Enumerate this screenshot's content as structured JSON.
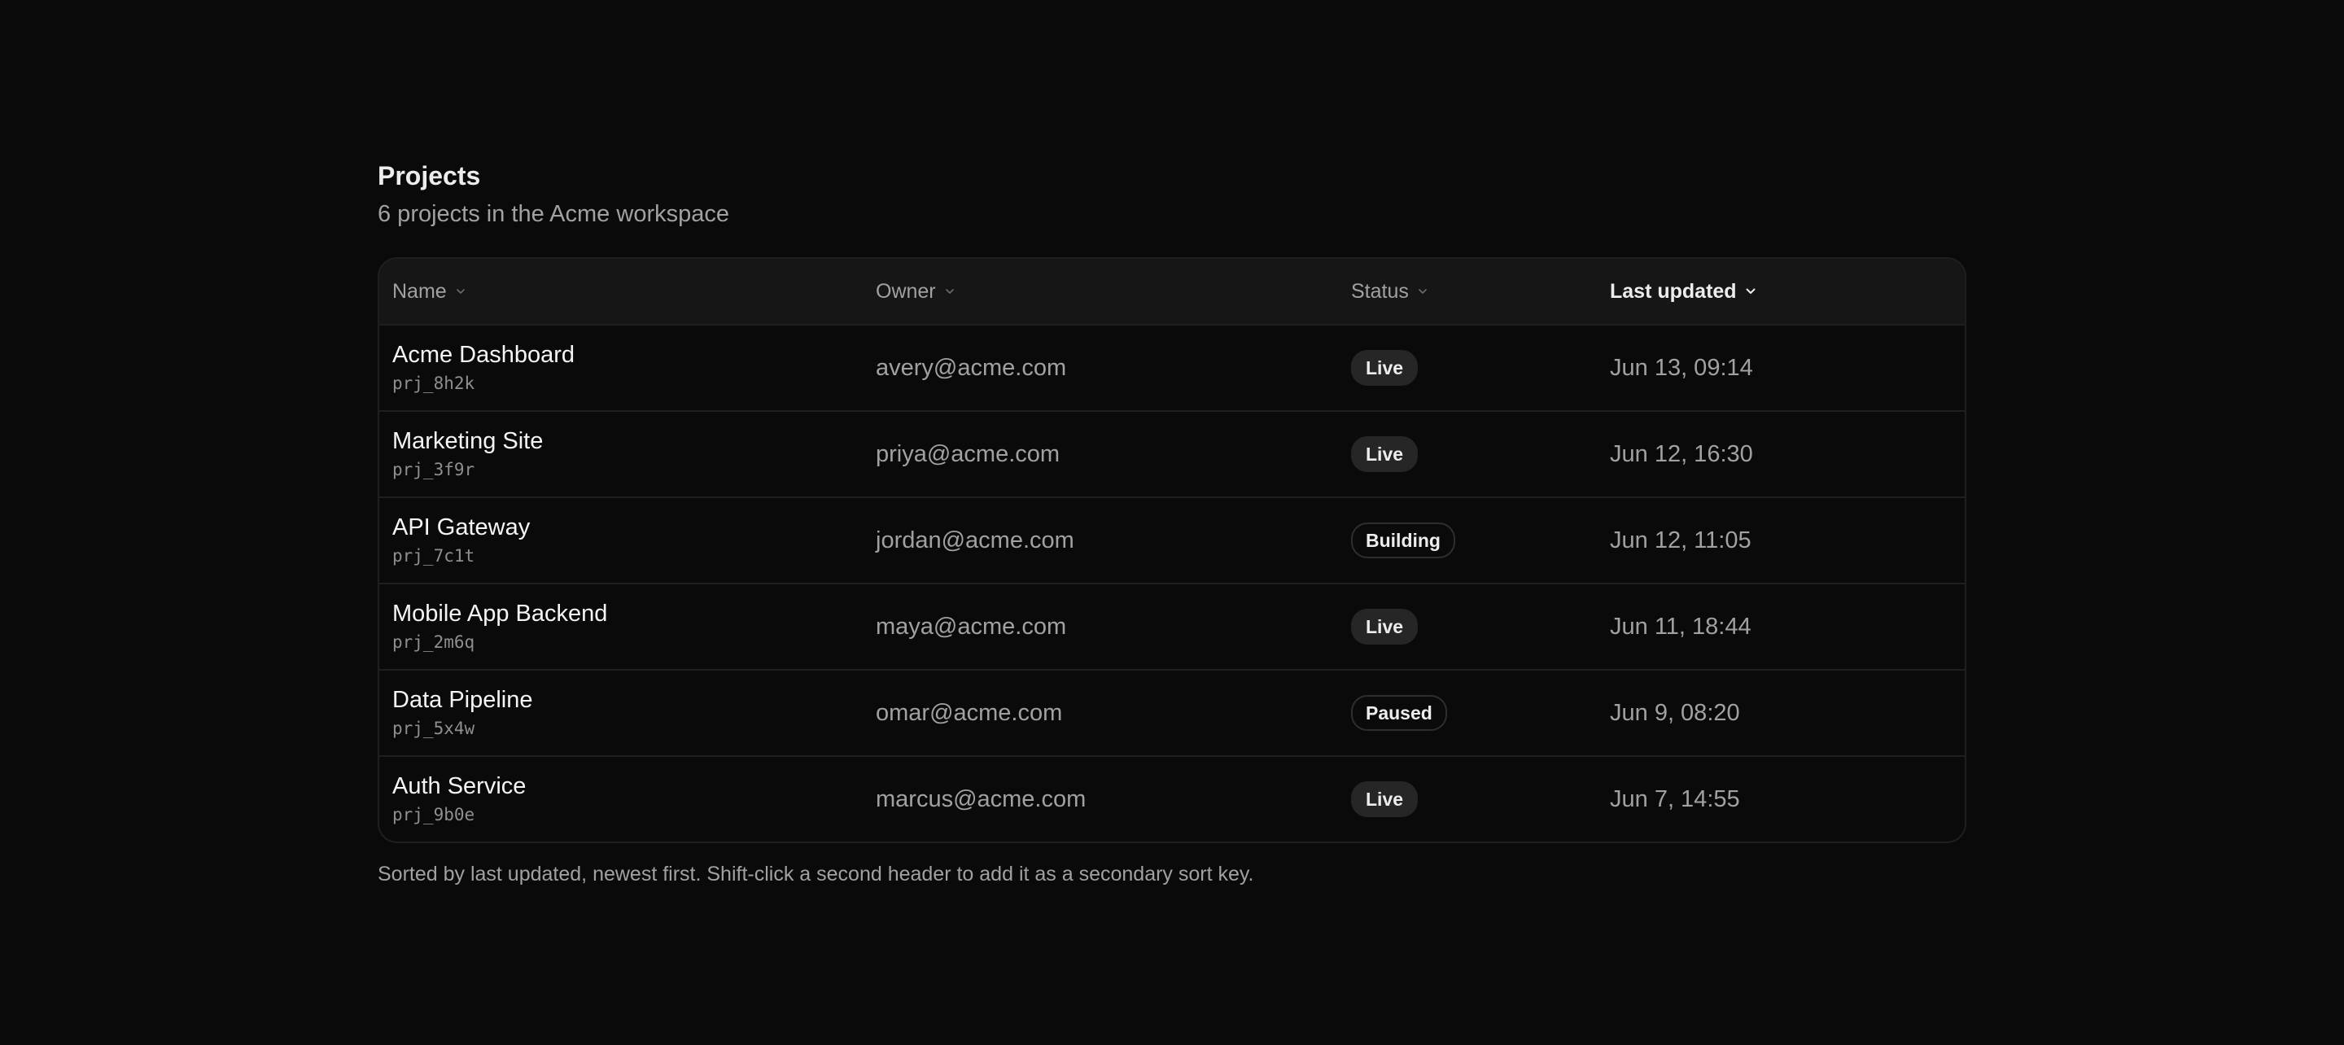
{
  "header": {
    "title": "Projects",
    "subtitle": "6 projects in the Acme workspace"
  },
  "table": {
    "columns": [
      {
        "label": "Name",
        "sort": "none"
      },
      {
        "label": "Owner",
        "sort": "none"
      },
      {
        "label": "Status",
        "sort": "none"
      },
      {
        "label": "Last updated",
        "sort": "descending"
      }
    ],
    "rows": [
      {
        "name": "Acme Dashboard",
        "id": "prj_8h2k",
        "owner": "avery@acme.com",
        "status": "Live",
        "updated": "Jun 13, 09:14"
      },
      {
        "name": "Marketing Site",
        "id": "prj_3f9r",
        "owner": "priya@acme.com",
        "status": "Live",
        "updated": "Jun 12, 16:30"
      },
      {
        "name": "API Gateway",
        "id": "prj_7c1t",
        "owner": "jordan@acme.com",
        "status": "Building",
        "updated": "Jun 12, 11:05"
      },
      {
        "name": "Mobile App Backend",
        "id": "prj_2m6q",
        "owner": "maya@acme.com",
        "status": "Live",
        "updated": "Jun 11, 18:44"
      },
      {
        "name": "Data Pipeline",
        "id": "prj_5x4w",
        "owner": "omar@acme.com",
        "status": "Paused",
        "updated": "Jun 9, 08:20"
      },
      {
        "name": "Auth Service",
        "id": "prj_9b0e",
        "owner": "marcus@acme.com",
        "status": "Live",
        "updated": "Jun 7, 14:55"
      }
    ]
  },
  "footnote": "Sorted by last updated, newest first. Shift-click a second header to add it as a secondary sort key.",
  "colors": {
    "background": "#0a0a0a",
    "header_row": "#161616",
    "border": "#1f1f1f",
    "text_primary": "#ededed",
    "text_muted": "#a1a1a1",
    "badge_fill": "#262626"
  }
}
